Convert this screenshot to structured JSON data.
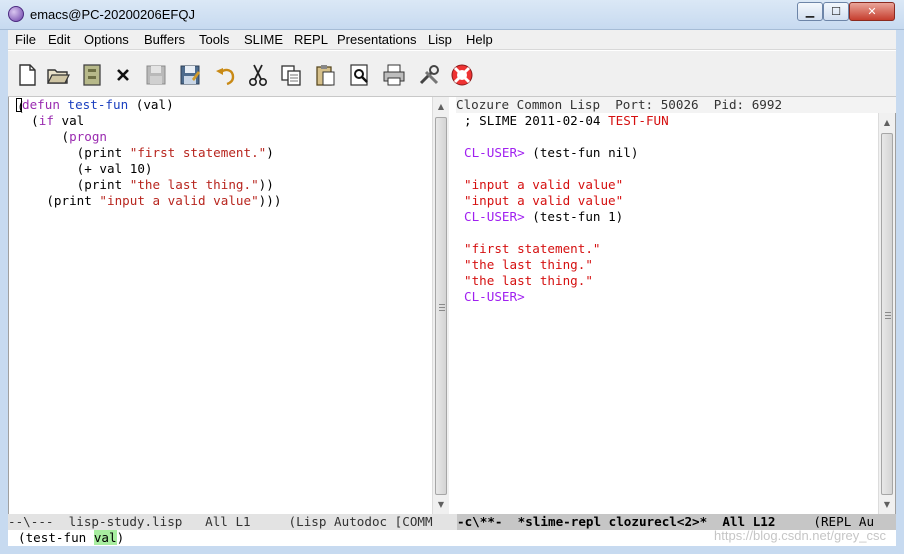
{
  "window": {
    "title": "emacs@PC-20200206EFQJ",
    "minimize": "0",
    "maximize": "1",
    "close": "r"
  },
  "menu": [
    "File",
    "Edit",
    "Options",
    "Buffers",
    "Tools",
    "SLIME",
    "REPL",
    "Presentations",
    "Lisp",
    "Help"
  ],
  "toolbar": [
    "new-file-icon",
    "open-folder-icon",
    "dired-icon",
    "close-buffer-icon",
    "save-icon",
    "save-as-icon",
    "undo-icon",
    "cut-icon",
    "copy-icon",
    "paste-icon",
    "search-icon",
    "print-icon",
    "preferences-icon",
    "help-icon"
  ],
  "left_buffer": {
    "lines": [
      {
        "indent": "",
        "parts": [
          [
            "",
            "("
          ],
          [
            "kw",
            "defun"
          ],
          [
            "",
            " "
          ],
          [
            "fn",
            "test-fun"
          ],
          [
            "",
            " (val)"
          ]
        ]
      },
      {
        "indent": "  ",
        "parts": [
          [
            "",
            "("
          ],
          [
            "kw",
            "if"
          ],
          [
            "",
            " val"
          ]
        ]
      },
      {
        "indent": "      ",
        "parts": [
          [
            "",
            "("
          ],
          [
            "kw",
            "progn"
          ]
        ]
      },
      {
        "indent": "        ",
        "parts": [
          [
            "",
            "(print "
          ],
          [
            "str",
            "\"first statement.\""
          ],
          [
            "",
            ")"
          ]
        ]
      },
      {
        "indent": "        ",
        "parts": [
          [
            "",
            "(+ val 10)"
          ]
        ]
      },
      {
        "indent": "        ",
        "parts": [
          [
            "",
            "(print "
          ],
          [
            "str",
            "\"the last thing.\""
          ],
          [
            "",
            "))"
          ]
        ]
      },
      {
        "indent": "    ",
        "parts": [
          [
            "",
            "(print "
          ],
          [
            "str",
            "\"input a valid value\""
          ],
          [
            "",
            ")))"
          ]
        ]
      }
    ]
  },
  "repl": {
    "header": "Clozure Common Lisp  Port: 50026  Pid: 6992",
    "lines": [
      [
        [
          "",
          "; SLIME 2011-02-04 "
        ],
        [
          "out",
          "TEST-FUN"
        ]
      ],
      [],
      [
        [
          "prompt",
          "CL-USER> "
        ],
        [
          "",
          "(test-fun nil)"
        ]
      ],
      [],
      [
        [
          "out",
          "\"input a valid value\""
        ]
      ],
      [
        [
          "out",
          "\"input a valid value\""
        ]
      ],
      [
        [
          "prompt",
          "CL-USER> "
        ],
        [
          "",
          "(test-fun 1)"
        ]
      ],
      [],
      [
        [
          "out",
          "\"first statement.\""
        ]
      ],
      [
        [
          "out",
          "\"the last thing.\""
        ]
      ],
      [
        [
          "out",
          "\"the last thing.\""
        ]
      ],
      [
        [
          "prompt",
          "CL-USER> "
        ]
      ]
    ]
  },
  "modeline_left": "--\\---  lisp-study.lisp   All L1     (Lisp Autodoc [COMM",
  "modeline_right_bold": "-c\\**-  *slime-repl clozurecl<2>*  All L12",
  "modeline_right_rest": "     (REPL Au",
  "minibuffer": {
    "before": "(test-fun ",
    "highlight": "val",
    "after": ")"
  },
  "watermark": "https://blog.csdn.net/grey_csc"
}
